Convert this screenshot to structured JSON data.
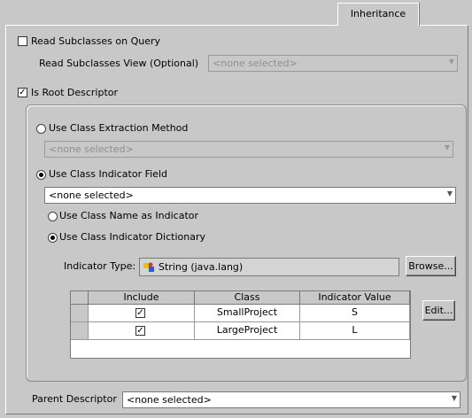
{
  "tabs": [
    {
      "label": "Inheritance"
    }
  ],
  "read_subclasses": {
    "label": "Read Subclasses on Query",
    "checked": false
  },
  "read_subclasses_view": {
    "label": "Read Subclasses View (Optional)",
    "value": "<none selected>"
  },
  "is_root_descriptor": {
    "label": "Is Root Descriptor",
    "checked": true
  },
  "class_extraction": {
    "label": "Use Class Extraction Method",
    "selected": false,
    "value": "<none selected>"
  },
  "class_indicator_field": {
    "label": "Use Class Indicator Field",
    "selected": true,
    "value": "<none selected>"
  },
  "class_name_indicator": {
    "label": "Use Class Name as Indicator",
    "selected": false
  },
  "class_indicator_dictionary": {
    "label": "Use Class Indicator Dictionary",
    "selected": true
  },
  "indicator_type": {
    "label": "Indicator Type:",
    "value": "String (java.lang)",
    "browse_label": "Browse..."
  },
  "indicator_table": {
    "columns": [
      "Include",
      "Class",
      "Indicator Value"
    ],
    "rows": [
      {
        "include": true,
        "class": "SmallProject",
        "value": "S"
      },
      {
        "include": true,
        "class": "LargeProject",
        "value": "L"
      }
    ],
    "edit_label": "Edit..."
  },
  "parent_descriptor": {
    "label": "Parent Descriptor",
    "value": "<none selected>"
  },
  "icons": {
    "checkmark": "check-icon",
    "dropdown": "chevron-down-icon",
    "type": "class-type-icon"
  }
}
